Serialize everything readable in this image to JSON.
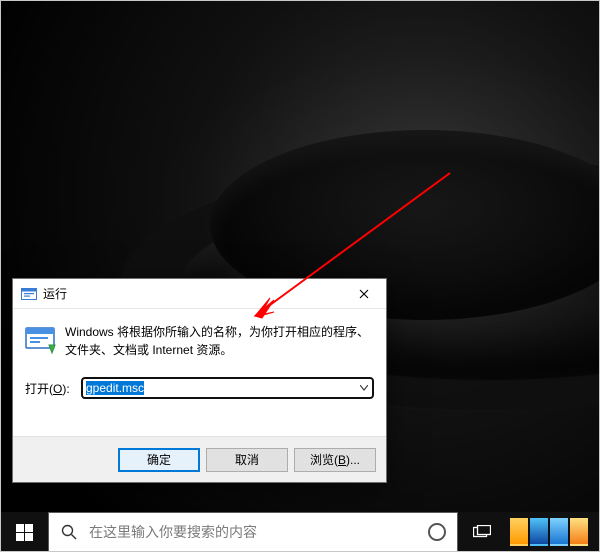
{
  "dialog": {
    "title": "运行",
    "description": "Windows 将根据你所输入的名称，为你打开相应的程序、文件夹、文档或 Internet 资源。",
    "open_label_prefix": "打开(",
    "open_label_key": "O",
    "open_label_suffix": "):",
    "input_value": "gpedit.msc",
    "buttons": {
      "ok": "确定",
      "cancel": "取消",
      "browse_prefix": "浏览(",
      "browse_key": "B",
      "browse_suffix": ")..."
    }
  },
  "taskbar": {
    "search_placeholder": "在这里输入你要搜索的内容"
  }
}
